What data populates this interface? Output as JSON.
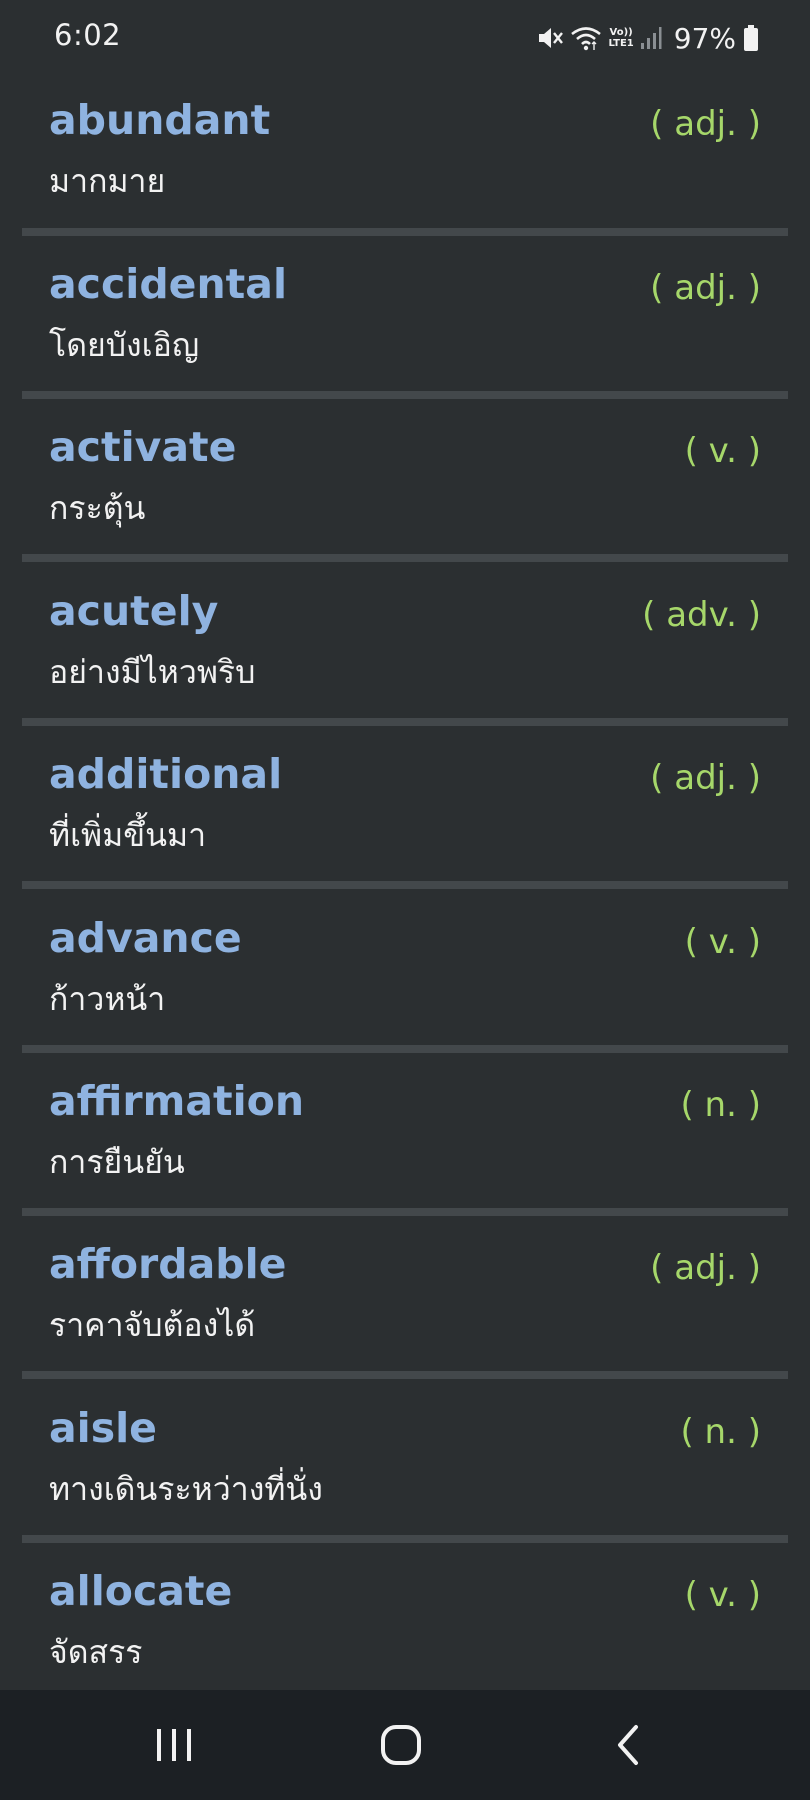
{
  "status_bar": {
    "time": "6:02",
    "network_label_top": "Vo))",
    "network_label_bottom": "LTE1",
    "battery": "97%"
  },
  "colors": {
    "background": "#2b2f31",
    "term": "#8fb3e0",
    "meaning": "#f2f2f2",
    "part_of_speech": "#a6d76a",
    "divider": "#43484b",
    "nav_bar": "#1c2024"
  },
  "words": [
    {
      "term": "abundant",
      "meaning": "มากมาย",
      "pos": "( adj. )"
    },
    {
      "term": "accidental",
      "meaning": "โดยบังเอิญ",
      "pos": "( adj. )"
    },
    {
      "term": "activate",
      "meaning": "กระตุ้น",
      "pos": "( v. )"
    },
    {
      "term": "acutely",
      "meaning": "อย่างมีไหวพริบ",
      "pos": "( adv. )"
    },
    {
      "term": "additional",
      "meaning": "ที่เพิ่มขึ้นมา",
      "pos": "( adj. )"
    },
    {
      "term": "advance",
      "meaning": "ก้าวหน้า",
      "pos": "( v. )"
    },
    {
      "term": "affirmation",
      "meaning": "การยืนยัน",
      "pos": "( n. )"
    },
    {
      "term": "affordable",
      "meaning": "ราคาจับต้องได้",
      "pos": "( adj. )"
    },
    {
      "term": "aisle",
      "meaning": "ทางเดินระหว่างที่นั่ง",
      "pos": "( n. )"
    },
    {
      "term": "allocate",
      "meaning": "จัดสรร",
      "pos": "( v. )"
    }
  ],
  "nav_bar": {
    "icons": [
      "recent-apps-icon",
      "home-icon",
      "back-icon"
    ]
  }
}
